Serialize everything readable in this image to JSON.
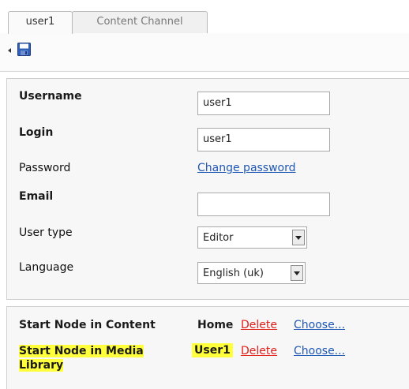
{
  "tabs": [
    {
      "label": "user1"
    },
    {
      "label": "Content Channel"
    }
  ],
  "toolbar": {
    "save_icon": "floppy-disk-icon",
    "back_icon": "arrow-left-icon"
  },
  "form": {
    "username": {
      "label": "Username",
      "value": "user1"
    },
    "login": {
      "label": "Login",
      "value": "user1"
    },
    "password": {
      "label": "Password",
      "link": "Change password"
    },
    "email": {
      "label": "Email",
      "value": ""
    },
    "user_type": {
      "label": "User type",
      "selected": "Editor"
    },
    "language": {
      "label": "Language",
      "selected": "English (uk)"
    }
  },
  "start_nodes": {
    "content": {
      "label": "Start Node in Content",
      "node": "Home",
      "delete": "Delete",
      "choose": "Choose..."
    },
    "media": {
      "label_line1": "Start Node in Media",
      "label_line2": "Library",
      "node": "User1",
      "delete": "Delete",
      "choose": "Choose..."
    }
  },
  "colors": {
    "link": "#1f57b5",
    "delete_link": "#e0201b",
    "highlight": "#ffff3c"
  }
}
